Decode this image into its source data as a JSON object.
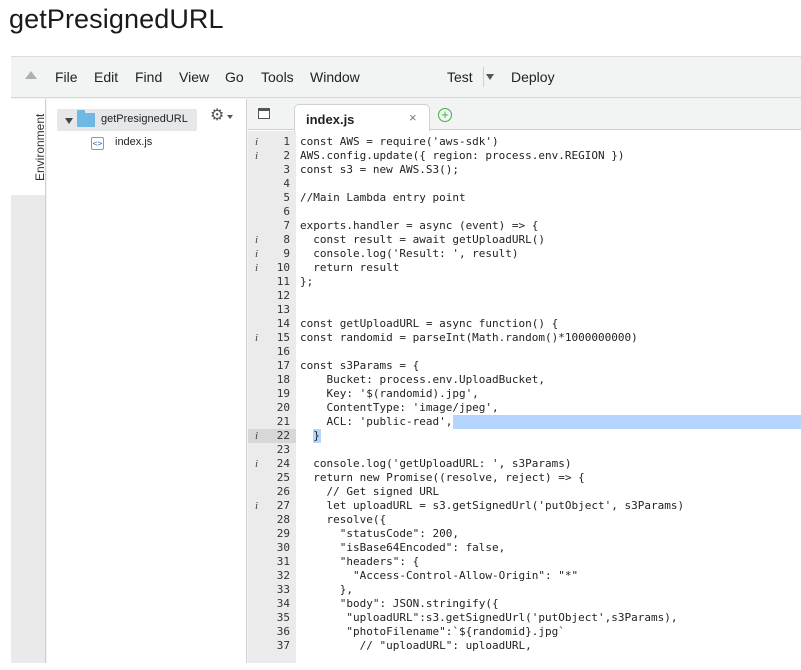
{
  "page": {
    "title": "getPresignedURL"
  },
  "menubar": {
    "items": [
      "File",
      "Edit",
      "Find",
      "View",
      "Go",
      "Tools",
      "Window"
    ],
    "test_label": "Test",
    "deploy_label": "Deploy"
  },
  "sidebar": {
    "environment_label": "Environment"
  },
  "file_tree": {
    "root_label": "getPresignedURL",
    "files": [
      "index.js"
    ]
  },
  "editor": {
    "tab_label": "index.js",
    "tab_close": "×",
    "add_tab": "+",
    "active_line": 22,
    "lines": [
      {
        "n": "1",
        "info": "i",
        "code": "const AWS = require('aws-sdk')"
      },
      {
        "n": "2",
        "info": "i",
        "code": "AWS.config.update({ region: process.env.REGION })"
      },
      {
        "n": "3",
        "info": "",
        "code": "const s3 = new AWS.S3();"
      },
      {
        "n": "4",
        "info": "",
        "code": ""
      },
      {
        "n": "5",
        "info": "",
        "code": "//Main Lambda entry point"
      },
      {
        "n": "6",
        "info": "",
        "code": ""
      },
      {
        "n": "7",
        "info": "",
        "code": "exports.handler = async (event) => {"
      },
      {
        "n": "8",
        "info": "i",
        "code": "  const result = await getUploadURL()"
      },
      {
        "n": "9",
        "info": "i",
        "code": "  console.log('Result: ', result)"
      },
      {
        "n": "10",
        "info": "i",
        "code": "  return result"
      },
      {
        "n": "11",
        "info": "",
        "code": "};"
      },
      {
        "n": "12",
        "info": "",
        "code": ""
      },
      {
        "n": "13",
        "info": "",
        "code": ""
      },
      {
        "n": "14",
        "info": "",
        "code": "const getUploadURL = async function() {"
      },
      {
        "n": "15",
        "info": "i",
        "code": "const randomid = parseInt(Math.random()*1000000000)"
      },
      {
        "n": "16",
        "info": "",
        "code": ""
      },
      {
        "n": "17",
        "info": "",
        "code": "const s3Params = {"
      },
      {
        "n": "18",
        "info": "",
        "code": "    Bucket: process.env.UploadBucket,"
      },
      {
        "n": "19",
        "info": "",
        "code": "    Key: '$(randomid).jpg',"
      },
      {
        "n": "20",
        "info": "",
        "code": "    ContentType: 'image/jpeg',"
      },
      {
        "n": "21",
        "info": "",
        "code": "    ACL: 'public-read',"
      },
      {
        "n": "22",
        "info": "i",
        "code": "  }"
      },
      {
        "n": "23",
        "info": "",
        "code": ""
      },
      {
        "n": "24",
        "info": "i",
        "code": "  console.log('getUploadURL: ', s3Params)"
      },
      {
        "n": "25",
        "info": "",
        "code": "  return new Promise((resolve, reject) => {"
      },
      {
        "n": "26",
        "info": "",
        "code": "    // Get signed URL"
      },
      {
        "n": "27",
        "info": "i",
        "code": "    let uploadURL = s3.getSignedUrl('putObject', s3Params)"
      },
      {
        "n": "28",
        "info": "",
        "code": "    resolve({"
      },
      {
        "n": "29",
        "info": "",
        "code": "      \"statusCode\": 200,"
      },
      {
        "n": "30",
        "info": "",
        "code": "      \"isBase64Encoded\": false,"
      },
      {
        "n": "31",
        "info": "",
        "code": "      \"headers\": {"
      },
      {
        "n": "32",
        "info": "",
        "code": "        \"Access-Control-Allow-Origin\": \"*\""
      },
      {
        "n": "33",
        "info": "",
        "code": "      },"
      },
      {
        "n": "34",
        "info": "",
        "code": "      \"body\": JSON.stringify({"
      },
      {
        "n": "35",
        "info": "",
        "code": "       \"uploadURL\":s3.getSignedUrl('putObject',s3Params),"
      },
      {
        "n": "36",
        "info": "",
        "code": "       \"photoFilename\":`${randomid}.jpg`"
      },
      {
        "n": "37",
        "info": "",
        "code": "         // \"uploadURL\": uploadURL,"
      }
    ]
  }
}
